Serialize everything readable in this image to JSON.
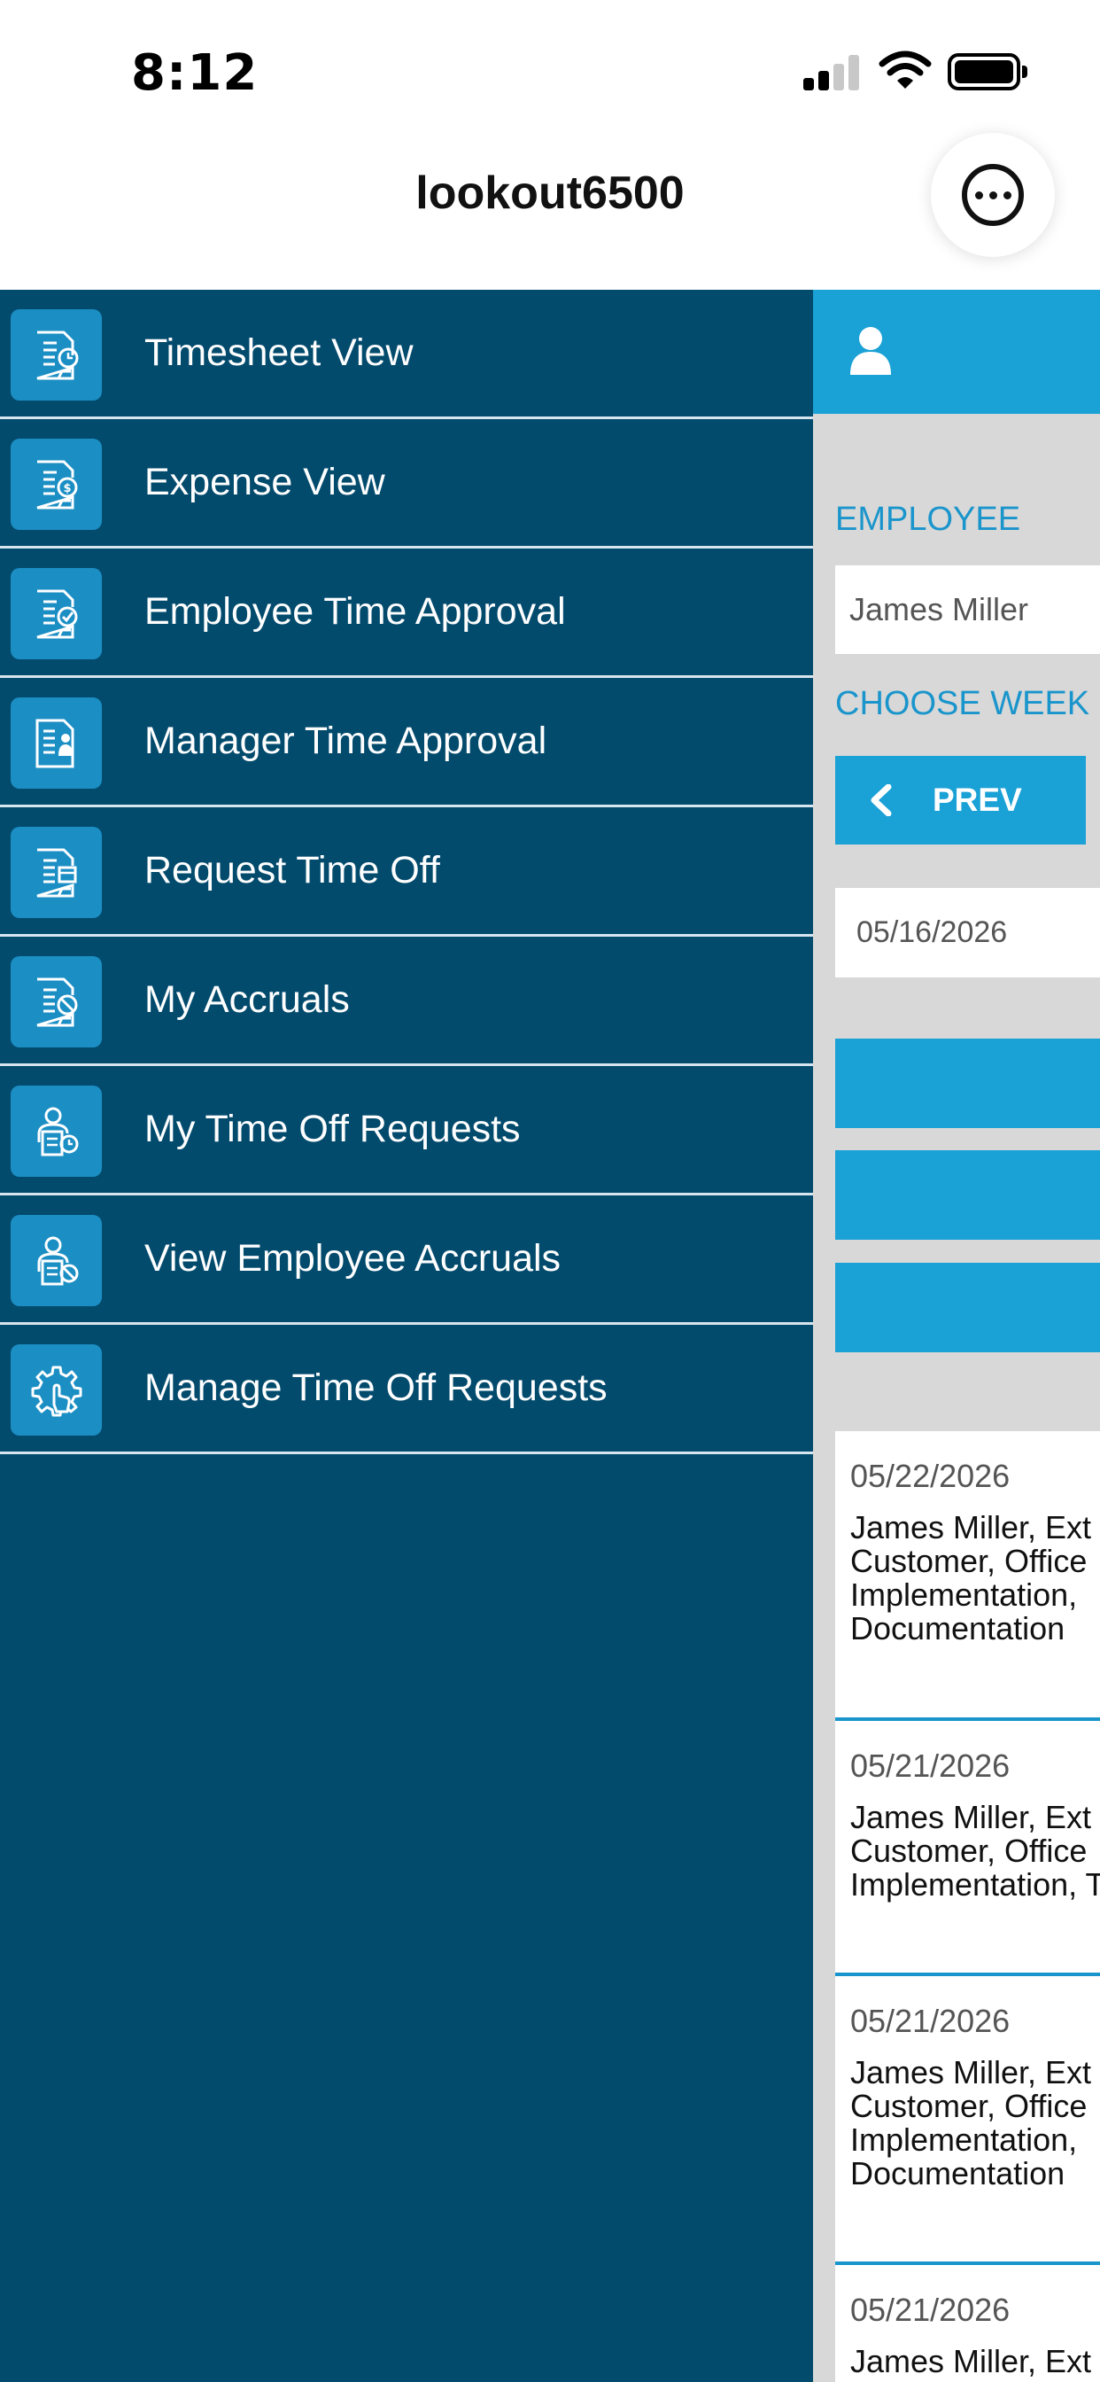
{
  "status_bar": {
    "time": "8:12"
  },
  "header": {
    "title": "lookout6500"
  },
  "menu": {
    "items": [
      {
        "label": "Timesheet View",
        "icon": "timesheet-clock-icon"
      },
      {
        "label": "Expense View",
        "icon": "expense-dollar-icon"
      },
      {
        "label": "Employee Time Approval",
        "icon": "employee-approval-check-icon"
      },
      {
        "label": "Manager Time Approval",
        "icon": "manager-approval-person-icon"
      },
      {
        "label": "Request Time Off",
        "icon": "request-time-off-icon"
      },
      {
        "label": "My Accruals",
        "icon": "accruals-icon"
      },
      {
        "label": "My Time Off Requests",
        "icon": "person-time-off-icon"
      },
      {
        "label": "View Employee Accruals",
        "icon": "person-accruals-icon"
      },
      {
        "label": "Manage Time Off Requests",
        "icon": "gear-hand-icon"
      }
    ]
  },
  "content": {
    "employee_label": "EMPLOYEE",
    "employee_value": "James Miller",
    "choose_week_label": "CHOOSE WEEK",
    "prev_label": "PREV",
    "week_date": "05/16/2026",
    "entries": [
      {
        "date": "05/22/2026",
        "text": "James Miller, Ext\nCustomer, Office\nImplementation,\nDocumentation"
      },
      {
        "date": "05/21/2026",
        "text": "James Miller, Ext\nCustomer, Office\nImplementation, T"
      },
      {
        "date": "05/21/2026",
        "text": "James Miller, Ext\nCustomer, Office\nImplementation,\nDocumentation"
      },
      {
        "date": "05/21/2026",
        "text": "James Miller, Ext"
      }
    ]
  },
  "colors": {
    "menu_background": "#034b6d",
    "menu_icon_tile": "#1b8ec4",
    "accent_blue": "#1aa1d6",
    "content_background": "#d8d8d8"
  }
}
